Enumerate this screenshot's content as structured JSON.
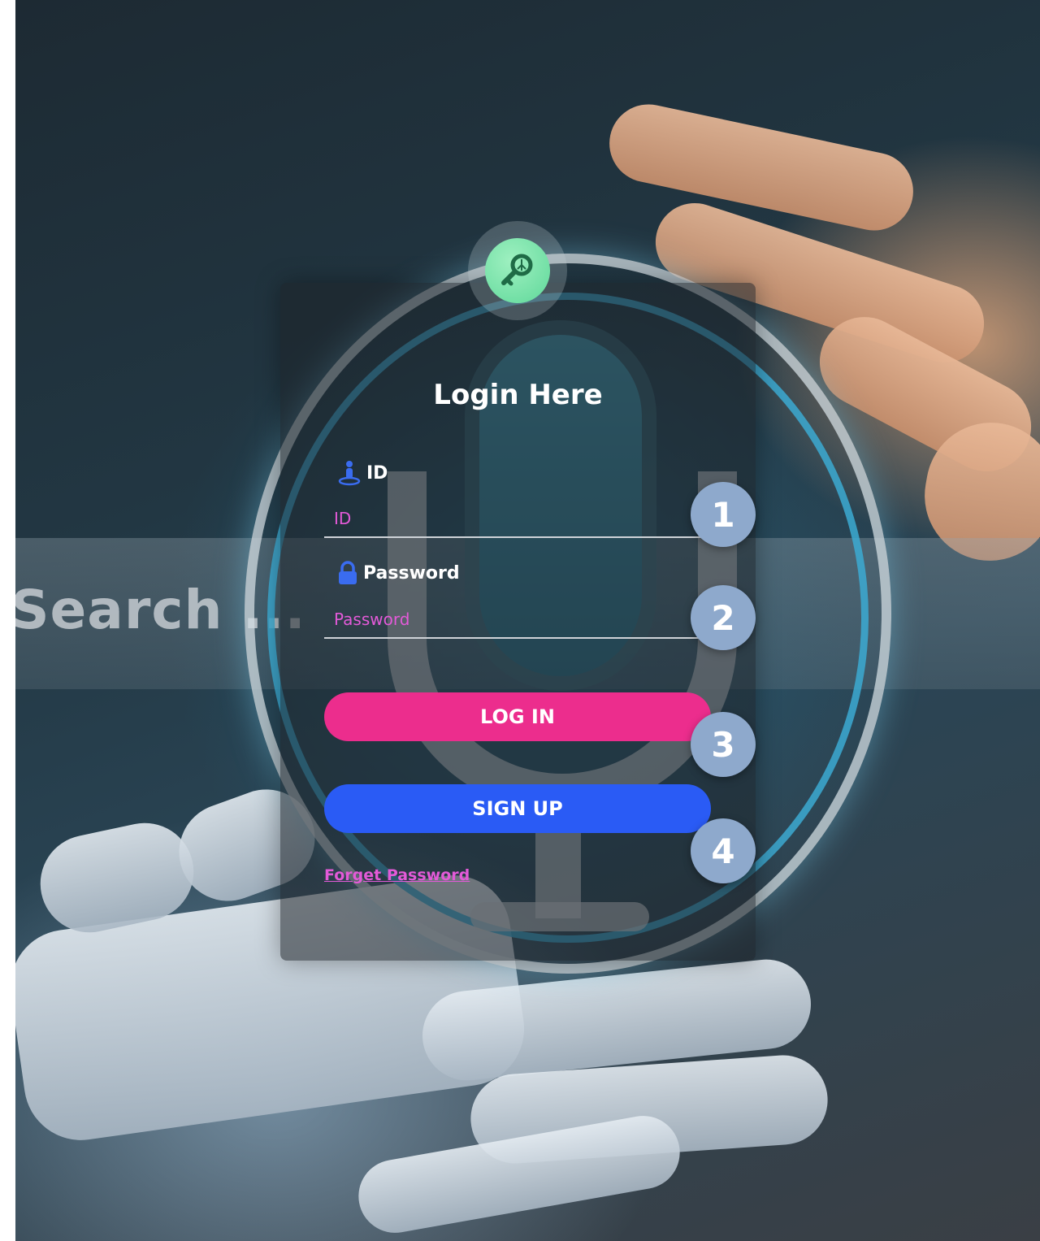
{
  "background": {
    "search_text": "Search ..."
  },
  "login": {
    "title": "Login Here",
    "id_label": "ID",
    "id_placeholder": "ID",
    "password_label": "Password",
    "password_placeholder": "Password",
    "login_button": "LOG IN",
    "signup_button": "SIGN UP",
    "forget_password": "Forget Password"
  },
  "markers": [
    "1",
    "2",
    "3",
    "4"
  ],
  "colors": {
    "login_button": "#ec2d8d",
    "signup_button": "#2a5bf5",
    "placeholder": "#e35ad8",
    "key_badge": "#5fd89a",
    "marker": "#8ea9cc"
  },
  "icons": {
    "badge": "key-icon",
    "id": "user-pin-icon",
    "password": "lock-icon"
  }
}
